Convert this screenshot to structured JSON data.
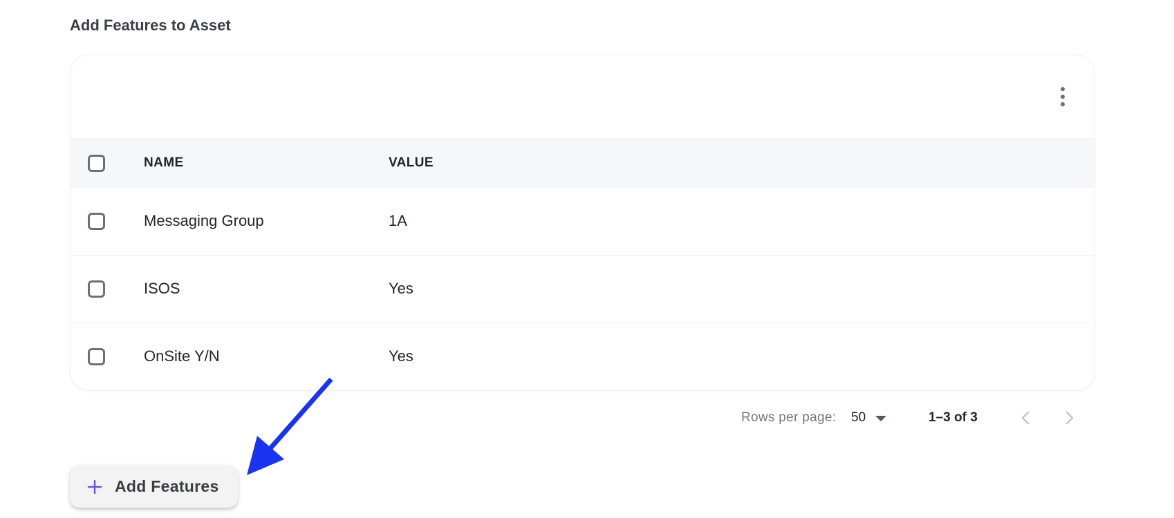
{
  "section": {
    "title": "Add Features to Asset"
  },
  "table": {
    "columns": {
      "name": "NAME",
      "value": "VALUE"
    },
    "rows": [
      {
        "name": "Messaging Group",
        "value": "1A"
      },
      {
        "name": "ISOS",
        "value": "Yes"
      },
      {
        "name": "OnSite Y/N",
        "value": "Yes"
      }
    ]
  },
  "pagination": {
    "rows_per_page_label": "Rows per page:",
    "rows_per_page_value": "50",
    "range_text": "1–3 of 3"
  },
  "add_button": {
    "label": "Add Features",
    "icon": "plus-icon"
  },
  "colors": {
    "accent": "#6d4df2",
    "annotation_arrow": "#1a33f0",
    "header_bg": "#f6f7f8"
  }
}
